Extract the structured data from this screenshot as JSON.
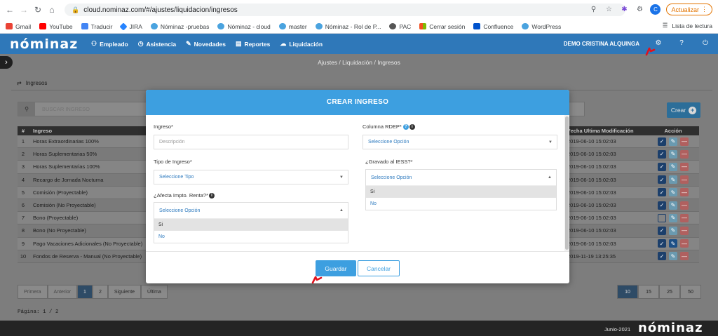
{
  "browser": {
    "url": "cloud.nominaz.com/#/ajustes/liquidacion/ingresos",
    "update_label": "Actualizar",
    "profile_initial": "C",
    "bookmarks": [
      "Gmail",
      "YouTube",
      "Traducir",
      "JIRA",
      "Nóminaz -pruebas",
      "Nóminaz - cloud",
      "master",
      "Nóminaz - Rol de P...",
      "PAC",
      "Cerrar sesión",
      "Confluence",
      "WordPress"
    ],
    "reading_list": "Lista de lectura"
  },
  "header": {
    "logo": "nóminaz",
    "menu": [
      "Empleado",
      "Asistencia",
      "Novedades",
      "Reportes",
      "Liquidación"
    ],
    "user": "DEMO CRISTINA ALQUINGA"
  },
  "breadcrumb": "Ajustes / Liquidación / Ingresos",
  "section": {
    "title": "Ingresos"
  },
  "search": {
    "placeholder": "BUSCAR INGRESO"
  },
  "create_button": "Crear",
  "table": {
    "headers": {
      "num": "#",
      "name": "Ingreso",
      "date": "Fecha Ultima Modificación",
      "action": "Acción"
    },
    "rows": [
      {
        "num": "1",
        "name": "Horas Extraordinarias 100%",
        "date": "2019-06-10 15:02:03",
        "checked": true,
        "edit_active": false
      },
      {
        "num": "2",
        "name": "Horas Suplementarias 50%",
        "date": "2019-06-10 15:02:03",
        "checked": true,
        "edit_active": false
      },
      {
        "num": "3",
        "name": "Horas Suplementarias 100%",
        "date": "2019-06-10 15:02:03",
        "checked": true,
        "edit_active": false
      },
      {
        "num": "4",
        "name": "Recargo de Jornada Nocturna",
        "date": "2019-06-10 15:02:03",
        "checked": true,
        "edit_active": false
      },
      {
        "num": "5",
        "name": "Comisión (Proyectable)",
        "date": "2019-06-10 15:02:03",
        "checked": true,
        "edit_active": false
      },
      {
        "num": "6",
        "name": "Comisión (No Proyectable)",
        "date": "2019-06-10 15:02:03",
        "checked": true,
        "edit_active": false
      },
      {
        "num": "7",
        "name": "Bono (Proyectable)",
        "date": "2019-06-10 15:02:03",
        "checked": false,
        "edit_active": false
      },
      {
        "num": "8",
        "name": "Bono (No Proyectable)",
        "date": "2019-06-10 15:02:03",
        "checked": true,
        "edit_active": false
      },
      {
        "num": "9",
        "name": "Pago Vacaciones Adicionales (No Proyectable)",
        "date": "2019-06-10 15:02:03",
        "checked": true,
        "edit_active": true
      },
      {
        "num": "10",
        "name": "Fondos de Reserva - Manual (No Proyectable)",
        "date": "2019-11-19 13:25:35",
        "checked": true,
        "edit_active": false
      }
    ]
  },
  "pagination": {
    "first": "Primera",
    "prev": "Anterior",
    "pages": [
      "1",
      "2"
    ],
    "next": "Siguiente",
    "last": "Última",
    "sizes": [
      "10",
      "15",
      "25",
      "50"
    ],
    "info": "Página: 1 / 2"
  },
  "footer": {
    "date": "Junio-2021",
    "logo": "nóminaz"
  },
  "modal": {
    "title": "CREAR INGRESO",
    "ingreso": {
      "label": "Ingreso*",
      "placeholder": "Descripción"
    },
    "tipo": {
      "label": "Tipo de Ingreso*",
      "value": "Seleccione Tipo"
    },
    "renta": {
      "label": "¿Afecta Impto. Renta?*",
      "value": "Seleccione Opción",
      "options": [
        "Si",
        "No"
      ]
    },
    "rdep": {
      "label": "Columna RDEP*",
      "value": "Seleccione Opción"
    },
    "iess": {
      "label": "¿Gravado al IESS?*",
      "value": "Seleccione Opción",
      "options": [
        "Si",
        "No"
      ]
    },
    "save": "Guardar",
    "cancel": "Cancelar"
  },
  "colors": {
    "primary": "#3d9fe0",
    "header": "#2f78b9",
    "annotation": "#e0121d"
  }
}
